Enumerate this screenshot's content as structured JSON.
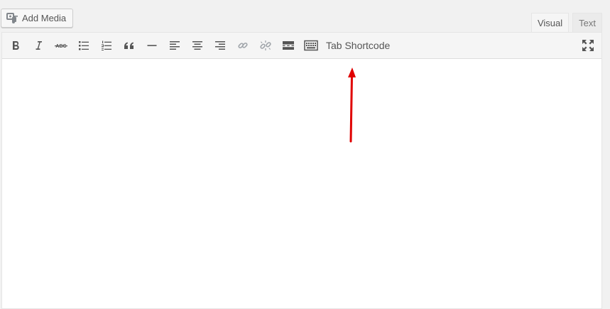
{
  "header": {
    "add_media_label": "Add Media"
  },
  "editor_tabs": [
    {
      "label": "Visual",
      "active": true
    },
    {
      "label": "Text",
      "active": false
    }
  ],
  "toolbar": {
    "buttons": [
      "bold-icon",
      "italic-icon",
      "strikethrough-icon",
      "bulleted-list-icon",
      "numbered-list-icon",
      "blockquote-icon",
      "horizontal-line-icon",
      "align-left-icon",
      "align-center-icon",
      "align-right-icon",
      "link-icon",
      "unlink-icon",
      "read-more-icon",
      "toolbar-toggle-icon",
      "fullscreen-icon"
    ],
    "tab_shortcode_label": "Tab Shortcode"
  },
  "annotation": {
    "arrow_color": "#e00000"
  },
  "colors": {
    "icon": "#555555",
    "disabled_icon": "#a0a5aa"
  }
}
